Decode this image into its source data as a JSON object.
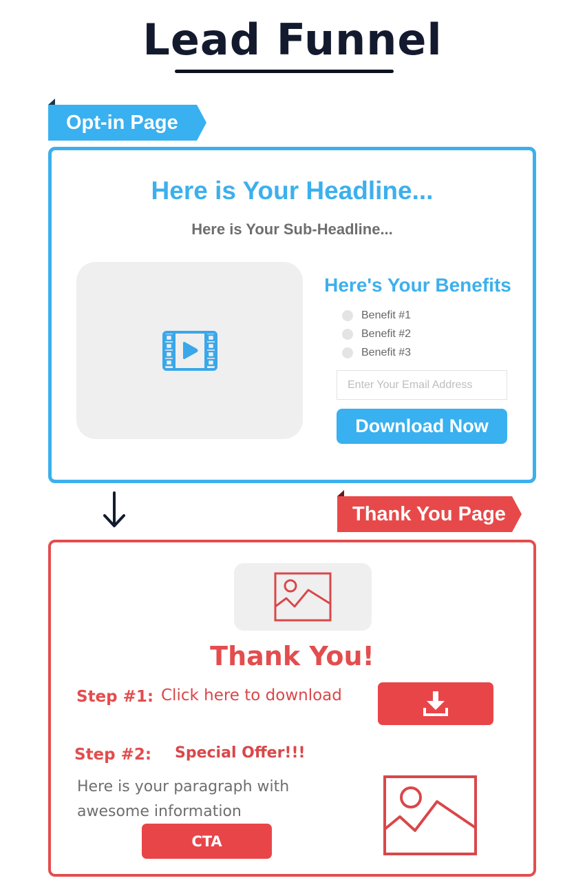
{
  "title": "Lead Funnel",
  "colors": {
    "dark": "#141a2e",
    "blue": "#39b0ef",
    "red": "#e84549",
    "gray_text": "#6e6e6e",
    "placeholder_bg": "#efefef"
  },
  "optin": {
    "tag": "Opt-in Page",
    "headline": "Here is Your Headline...",
    "subheadline": "Here is Your Sub-Headline...",
    "media_icon": "video-play-icon",
    "benefits_title": "Here's Your Benefits",
    "benefits": [
      "Benefit #1",
      "Benefit #2",
      "Benefit #3"
    ],
    "email_placeholder": "Enter Your Email Address",
    "email_value": "",
    "button_label": "Download Now"
  },
  "flow_arrow": "arrow-down-icon",
  "thankyou": {
    "tag": "Thank You Page",
    "image_icon": "image-icon",
    "title": "Thank You!",
    "step1": {
      "label": "Step #1:",
      "text": "Click here to download",
      "button_icon": "download-icon"
    },
    "step2": {
      "label": "Step #2:",
      "offer": "Special Offer!!!",
      "paragraph": "Here is your paragraph with awesome information",
      "cta_label": "CTA",
      "image_icon": "image-icon"
    }
  }
}
